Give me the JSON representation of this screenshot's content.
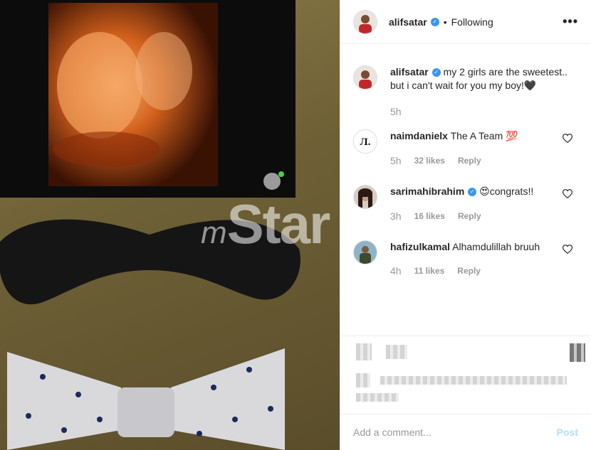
{
  "post": {
    "username": "alifsatar",
    "follow_status": "Following",
    "separator": "•",
    "more_label": "•••"
  },
  "caption": {
    "username": "alifsatar",
    "text": "my 2 girls are the sweetest.. but i can't wait for you my boy!🖤",
    "time": "5h"
  },
  "comments": [
    {
      "username": "naimdanielx",
      "text": "The A Team 💯",
      "time": "5h",
      "likes": "32 likes",
      "reply": "Reply"
    },
    {
      "username": "sarimahibrahim",
      "verified": true,
      "text": "😍congrats!!",
      "time": "3h",
      "likes": "16 likes",
      "reply": "Reply"
    },
    {
      "username": "hafizulkamal",
      "text": "Alhamdulillah bruuh",
      "time": "4h",
      "likes": "11 likes",
      "reply": "Reply"
    }
  ],
  "add_comment": {
    "placeholder": "Add a comment...",
    "post_label": "Post"
  },
  "photo": {
    "watermark_prefix": "m",
    "watermark": "Star"
  },
  "colors": {
    "accent": "#3897f0",
    "post_disabled": "#b2dffc",
    "muted": "#999999"
  }
}
